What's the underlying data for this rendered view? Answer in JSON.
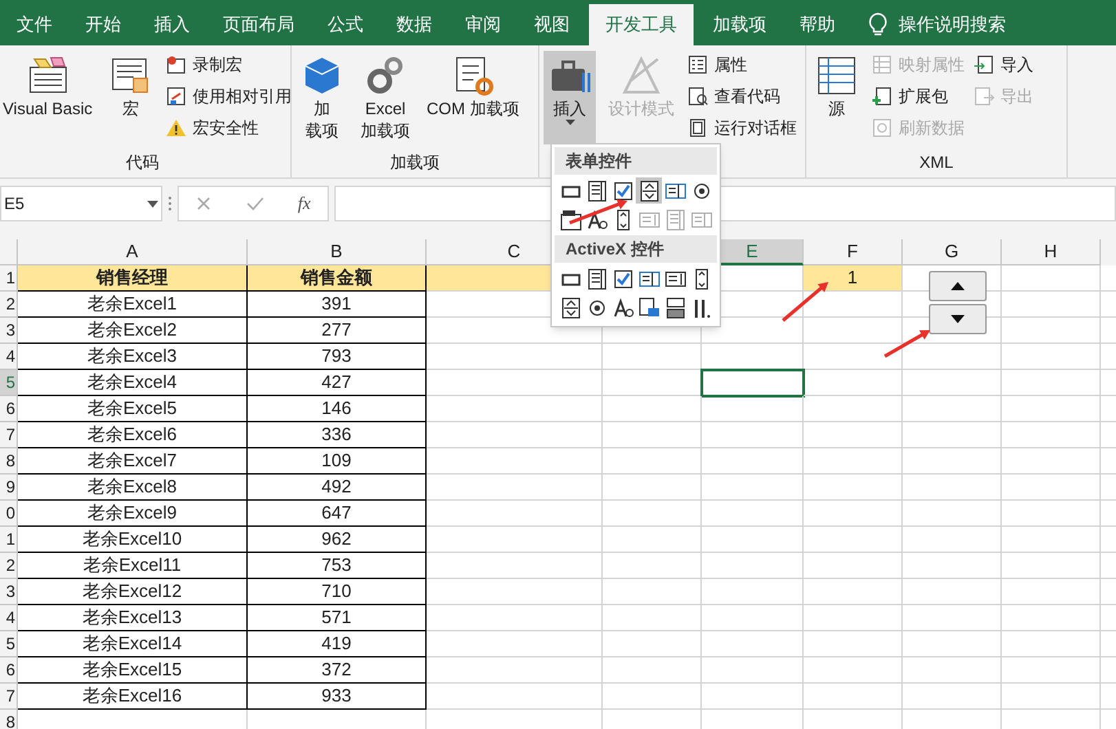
{
  "tabs": [
    {
      "label": "文件",
      "selected": false
    },
    {
      "label": "开始",
      "selected": false
    },
    {
      "label": "插入",
      "selected": false
    },
    {
      "label": "页面布局",
      "selected": false
    },
    {
      "label": "公式",
      "selected": false
    },
    {
      "label": "数据",
      "selected": false
    },
    {
      "label": "审阅",
      "selected": false
    },
    {
      "label": "视图",
      "selected": false
    },
    {
      "label": "开发工具",
      "selected": true
    },
    {
      "label": "加载项",
      "selected": false
    },
    {
      "label": "帮助",
      "selected": false
    }
  ],
  "search": {
    "label": "操作说明搜索"
  },
  "ribbon": {
    "groups": [
      {
        "label": "代码",
        "columns": [
          {
            "kind": "large",
            "items": [
              {
                "lines": [
                  "Visual Basic"
                ],
                "disabled": false
              }
            ]
          },
          {
            "kind": "large",
            "items": [
              {
                "lines": [
                  "宏"
                ],
                "disabled": false
              }
            ]
          },
          {
            "kind": "small",
            "items": [
              {
                "lines": [
                  "录制宏"
                ],
                "disabled": false
              },
              {
                "lines": [
                  "使用相对引用"
                ],
                "disabled": false
              },
              {
                "lines": [
                  "宏安全性"
                ],
                "disabled": false
              }
            ]
          }
        ]
      },
      {
        "label": "加载项",
        "columns": [
          {
            "kind": "large",
            "items": [
              {
                "lines": [
                  "加",
                  "载项"
                ],
                "disabled": false
              }
            ]
          },
          {
            "kind": "large",
            "items": [
              {
                "lines": [
                  "Excel",
                  "加载项"
                ],
                "disabled": false
              }
            ]
          },
          {
            "kind": "large",
            "items": [
              {
                "lines": [
                  "COM 加载项"
                ],
                "disabled": false
              }
            ]
          }
        ]
      },
      {
        "columns": [
          {
            "kind": "large",
            "items": [
              {
                "lines": [
                  "插入"
                ],
                "disabled": false,
                "expanded": true
              }
            ]
          },
          {
            "kind": "large",
            "items": [
              {
                "lines": [
                  "设计模式"
                ],
                "disabled": true
              }
            ]
          },
          {
            "kind": "small",
            "items": [
              {
                "lines": [
                  "属性"
                ],
                "disabled": false
              },
              {
                "lines": [
                  "查看代码"
                ],
                "disabled": false
              },
              {
                "lines": [
                  "运行对话框"
                ],
                "disabled": false
              }
            ]
          }
        ]
      },
      {
        "label": "XML",
        "columns": [
          {
            "kind": "large",
            "items": [
              {
                "lines": [
                  "源"
                ],
                "disabled": false
              }
            ]
          },
          {
            "kind": "small",
            "items": [
              {
                "lines": [
                  "映射属性"
                ],
                "disabled": true
              },
              {
                "lines": [
                  "扩展包"
                ],
                "disabled": false
              },
              {
                "lines": [
                  "刷新数据"
                ],
                "disabled": true
              }
            ]
          },
          {
            "kind": "small",
            "items": [
              {
                "lines": [
                  "导入"
                ],
                "disabled": false
              },
              {
                "lines": [
                  "导出"
                ],
                "disabled": true
              }
            ]
          }
        ]
      }
    ]
  },
  "formula_bar": {
    "name_box": "E5",
    "fx": "fx"
  },
  "dropdown": {
    "sections": [
      {
        "title": "表单控件",
        "items": [
          {
            "disabled": false,
            "selected": false
          },
          {
            "disabled": false,
            "selected": false
          },
          {
            "disabled": false,
            "selected": false
          },
          {
            "disabled": false,
            "selected": true
          },
          {
            "disabled": false,
            "selected": false
          },
          {
            "disabled": false,
            "selected": false
          },
          {
            "disabled": false,
            "selected": false
          },
          {
            "disabled": false,
            "selected": false
          },
          {
            "disabled": false,
            "selected": false
          },
          {
            "disabled": true,
            "selected": false
          },
          {
            "disabled": true,
            "selected": false
          },
          {
            "disabled": true,
            "selected": false
          }
        ]
      },
      {
        "title": "ActiveX 控件",
        "items": [
          {
            "disabled": false,
            "selected": false
          },
          {
            "disabled": false,
            "selected": false
          },
          {
            "disabled": false,
            "selected": false
          },
          {
            "disabled": false,
            "selected": false
          },
          {
            "disabled": false,
            "selected": false
          },
          {
            "disabled": false,
            "selected": false
          },
          {
            "disabled": false,
            "selected": false
          },
          {
            "disabled": false,
            "selected": false
          },
          {
            "disabled": false,
            "selected": false
          },
          {
            "disabled": false,
            "selected": false
          },
          {
            "disabled": false,
            "selected": false
          },
          {
            "disabled": false,
            "selected": false
          }
        ]
      }
    ]
  },
  "sheet": {
    "columns": [
      {
        "label": "A",
        "selected": false
      },
      {
        "label": "B",
        "selected": false
      },
      {
        "label": "C",
        "selected": false
      },
      {
        "label": "E",
        "selected": true
      },
      {
        "label": "F",
        "selected": false
      },
      {
        "label": "G",
        "selected": false
      },
      {
        "label": "H",
        "selected": false
      }
    ],
    "linked_cell": "1",
    "rows": [
      {
        "header": "1",
        "kind": "header",
        "cells": [
          "销售经理",
          "销售金额"
        ],
        "selected": false
      },
      {
        "header": "2",
        "kind": "data",
        "cells": [
          "老余Excel1",
          "391"
        ],
        "selected": false
      },
      {
        "header": "3",
        "kind": "data",
        "cells": [
          "老余Excel2",
          "277"
        ],
        "selected": false
      },
      {
        "header": "4",
        "kind": "data",
        "cells": [
          "老余Excel3",
          "793"
        ],
        "selected": false
      },
      {
        "header": "5",
        "kind": "data",
        "cells": [
          "老余Excel4",
          "427"
        ],
        "selected": true
      },
      {
        "header": "6",
        "kind": "data",
        "cells": [
          "老余Excel5",
          "146"
        ],
        "selected": false
      },
      {
        "header": "7",
        "kind": "data",
        "cells": [
          "老余Excel6",
          "336"
        ],
        "selected": false
      },
      {
        "header": "8",
        "kind": "data",
        "cells": [
          "老余Excel7",
          "109"
        ],
        "selected": false
      },
      {
        "header": "9",
        "kind": "data",
        "cells": [
          "老余Excel8",
          "492"
        ],
        "selected": false
      },
      {
        "header": "0",
        "kind": "data",
        "cells": [
          "老余Excel9",
          "647"
        ],
        "selected": false
      },
      {
        "header": "1",
        "kind": "data",
        "cells": [
          "老余Excel10",
          "962"
        ],
        "selected": false
      },
      {
        "header": "2",
        "kind": "data",
        "cells": [
          "老余Excel11",
          "753"
        ],
        "selected": false
      },
      {
        "header": "3",
        "kind": "data",
        "cells": [
          "老余Excel12",
          "710"
        ],
        "selected": false
      },
      {
        "header": "4",
        "kind": "data",
        "cells": [
          "老余Excel13",
          "571"
        ],
        "selected": false
      },
      {
        "header": "5",
        "kind": "data",
        "cells": [
          "老余Excel14",
          "419"
        ],
        "selected": false
      },
      {
        "header": "6",
        "kind": "data",
        "cells": [
          "老余Excel15",
          "372"
        ],
        "selected": false
      },
      {
        "header": "7",
        "kind": "data",
        "cells": [
          "老余Excel16",
          "933"
        ],
        "selected": false
      },
      {
        "header": "8",
        "kind": "empty",
        "cells": [],
        "selected": false
      }
    ]
  }
}
